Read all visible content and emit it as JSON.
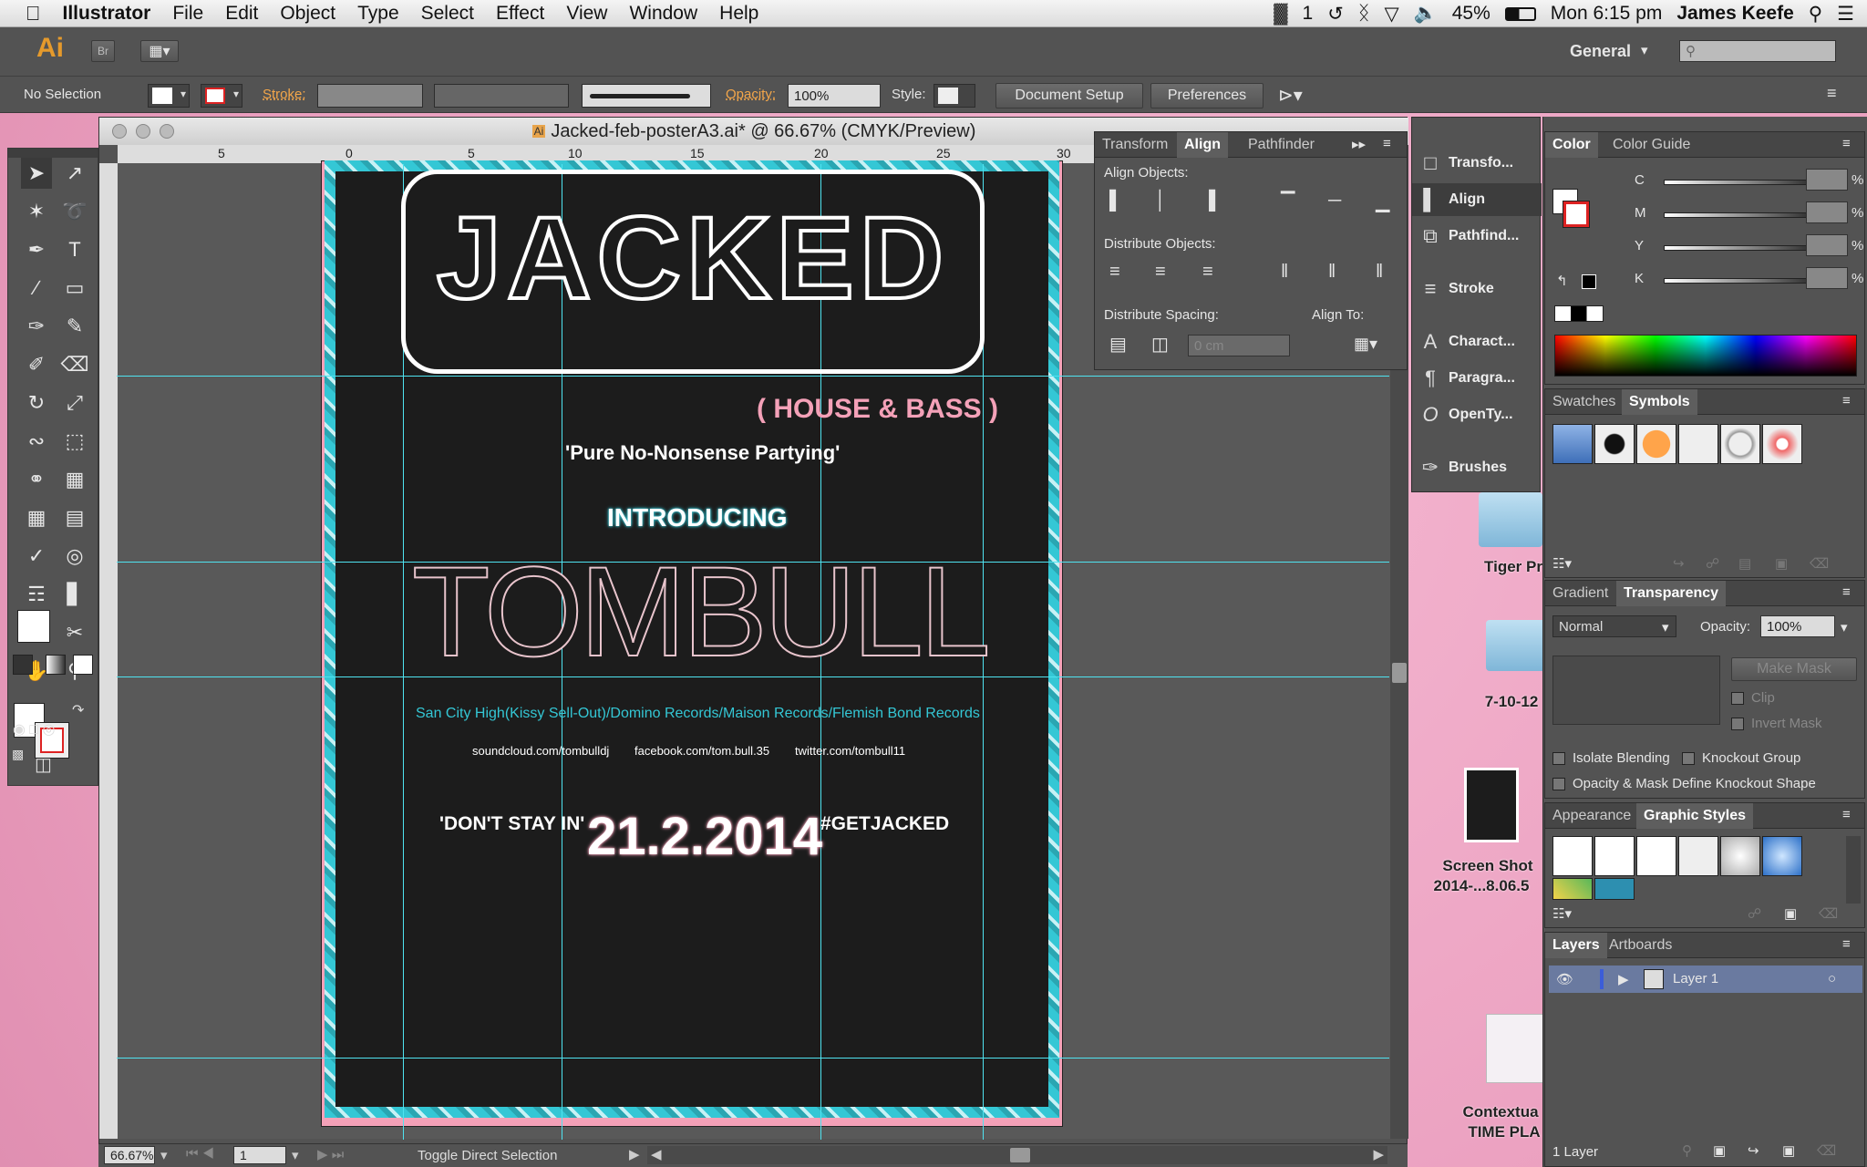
{
  "menubar": {
    "app": "Illustrator",
    "items": [
      "File",
      "Edit",
      "Object",
      "Type",
      "Select",
      "Effect",
      "View",
      "Window",
      "Help"
    ],
    "status": {
      "adobe_count": "1",
      "battery": "45%",
      "clock": "Mon 6:15 pm",
      "user": "James Keefe"
    }
  },
  "appbar": {
    "logo": "Ai",
    "bridge": "Br",
    "workspace": "General"
  },
  "control": {
    "selection": "No Selection",
    "stroke_label": "Stroke:",
    "opacity_label": "Opacity:",
    "opacity_value": "100%",
    "style_label": "Style:",
    "document_setup": "Document Setup",
    "preferences": "Preferences"
  },
  "document": {
    "title": "Jacked-feb-posterA3.ai* @ 66.67% (CMYK/Preview)",
    "ruler_h": [
      "5",
      "0",
      "5",
      "10",
      "15",
      "20",
      "25",
      "30"
    ],
    "zoom": "66.67%",
    "artboard_num": "1",
    "status_tool": "Toggle Direct Selection"
  },
  "poster": {
    "title": "JACKED",
    "subtitle": "( HOUSE & BASS )",
    "tagline": "'Pure No-Nonsense Partying'",
    "introducing": "INTRODUCING",
    "artist": "TOMBULL",
    "labels": "San City High(Kissy Sell-Out)/Domino Records/Maison Records/Flemish Bond Records",
    "link1": "soundcloud.com/tombulldj",
    "link2": "facebook.com/tom.bull.35",
    "link3": "twitter.com/tombull11",
    "left_slogan": "'DON'T STAY IN'",
    "date": "21.2.2014",
    "hashtag": "#GETJACKED"
  },
  "align_panel": {
    "tabs": [
      "Transform",
      "Align",
      "Pathfinder"
    ],
    "align_objects": "Align Objects:",
    "distribute_objects": "Distribute Objects:",
    "distribute_spacing": "Distribute Spacing:",
    "align_to": "Align To:",
    "spacing_value": "0 cm"
  },
  "icon_panels": [
    "Transfo...",
    "Align",
    "Pathfind...",
    "Stroke",
    "Charact...",
    "Paragra...",
    "OpenTy...",
    "Brushes"
  ],
  "color_panel": {
    "tabs": [
      "Color",
      "Color Guide"
    ],
    "channels": [
      "C",
      "M",
      "Y",
      "K"
    ],
    "unit": "%"
  },
  "swatches_panel": {
    "tabs": [
      "Swatches",
      "Symbols"
    ]
  },
  "transparency_panel": {
    "tabs": [
      "Gradient",
      "Transparency"
    ],
    "mode": "Normal",
    "opacity_label": "Opacity:",
    "opacity_value": "100%",
    "make_mask": "Make Mask",
    "clip": "Clip",
    "invert_mask": "Invert Mask",
    "isolate": "Isolate Blending",
    "knockout": "Knockout Group",
    "define_knockout": "Opacity & Mask Define Knockout Shape"
  },
  "appearance_panel": {
    "tabs": [
      "Appearance",
      "Graphic Styles"
    ]
  },
  "layers_panel": {
    "tabs": [
      "Layers",
      "Artboards"
    ],
    "layer_name": "Layer 1",
    "count": "1 Layer"
  },
  "desktop": {
    "items": [
      "Tiger Pr",
      "7-10-12",
      "Screen Shot",
      "2014-...8.06.5",
      "Contextua",
      "TIME PLA"
    ]
  },
  "colors": {
    "accent_cyan": "#34c7d5",
    "poster_bg": "#1c1c1c",
    "pink": "#f4a1b8",
    "ui_gray": "#535353"
  }
}
